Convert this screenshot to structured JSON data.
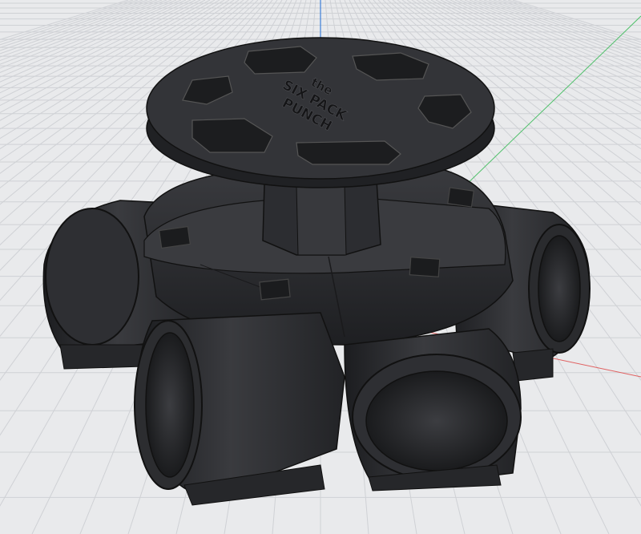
{
  "viewport": {
    "background": "#e9eaec",
    "grid_color": "#cfd1d5",
    "model_color": "#2b2c2f",
    "axis_colors": {
      "x": "#e06060",
      "y": "#3d7fd8",
      "z": "#4fc06a"
    }
  },
  "model": {
    "engraving": {
      "line1": "the",
      "line2": "SIX PACK",
      "line3": "PUNCH"
    }
  }
}
